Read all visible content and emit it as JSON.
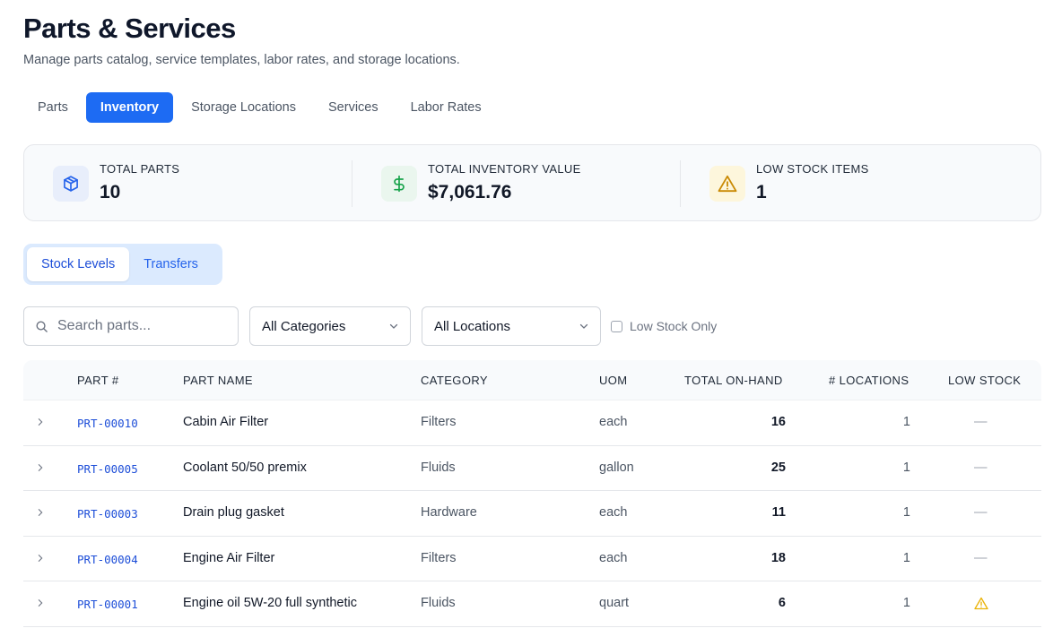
{
  "header": {
    "title": "Parts & Services",
    "subtitle": "Manage parts catalog, service templates, labor rates, and storage locations."
  },
  "tabs": [
    {
      "label": "Parts",
      "active": false
    },
    {
      "label": "Inventory",
      "active": true
    },
    {
      "label": "Storage Locations",
      "active": false
    },
    {
      "label": "Services",
      "active": false
    },
    {
      "label": "Labor Rates",
      "active": false
    }
  ],
  "stats": [
    {
      "label": "TOTAL PARTS",
      "value": "10",
      "icon": "box-icon",
      "icon_color": "#2563eb",
      "icon_bg": "#e8eefb"
    },
    {
      "label": "TOTAL INVENTORY VALUE",
      "value": "$7,061.76",
      "icon": "dollar-icon",
      "icon_color": "#16a34a",
      "icon_bg": "#eaf6ee"
    },
    {
      "label": "LOW STOCK ITEMS",
      "value": "1",
      "icon": "warning-icon",
      "icon_color": "#ca8a04",
      "icon_bg": "#fdf6dc"
    }
  ],
  "segment": {
    "options": [
      "Stock Levels",
      "Transfers"
    ],
    "selected": "Stock Levels"
  },
  "filters": {
    "search_placeholder": "Search parts...",
    "search_value": "",
    "category_value": "All Categories",
    "location_value": "All Locations",
    "low_stock_label": "Low Stock Only",
    "low_stock_checked": false
  },
  "table": {
    "columns": [
      "PART #",
      "PART NAME",
      "CATEGORY",
      "UOM",
      "TOTAL ON-HAND",
      "# LOCATIONS",
      "LOW STOCK"
    ],
    "rows": [
      {
        "part_no": "PRT-00010",
        "name": "Cabin Air Filter",
        "category": "Filters",
        "uom": "each",
        "on_hand": "16",
        "locations": "1",
        "low_stock": "—"
      },
      {
        "part_no": "PRT-00005",
        "name": "Coolant 50/50 premix",
        "category": "Fluids",
        "uom": "gallon",
        "on_hand": "25",
        "locations": "1",
        "low_stock": "—"
      },
      {
        "part_no": "PRT-00003",
        "name": "Drain plug gasket",
        "category": "Hardware",
        "uom": "each",
        "on_hand": "11",
        "locations": "1",
        "low_stock": "—"
      },
      {
        "part_no": "PRT-00004",
        "name": "Engine Air Filter",
        "category": "Filters",
        "uom": "each",
        "on_hand": "18",
        "locations": "1",
        "low_stock": "—"
      },
      {
        "part_no": "PRT-00001",
        "name": "Engine oil 5W-20 full synthetic",
        "category": "Fluids",
        "uom": "quart",
        "on_hand": "6",
        "locations": "1",
        "low_stock": "warning-icon"
      }
    ]
  }
}
